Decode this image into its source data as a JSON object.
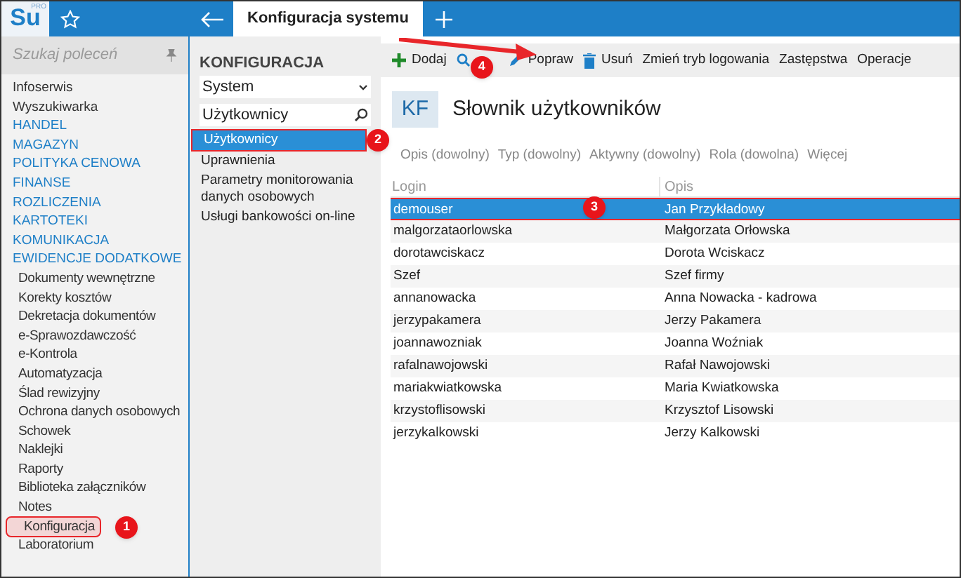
{
  "app": {
    "logo": "Su",
    "logo_badge": "PRO"
  },
  "tabs": [
    {
      "label": "Konfiguracja systemu",
      "selected": true
    }
  ],
  "sidebar": {
    "search": {
      "placeholder": "Szukaj poleceń"
    },
    "items": [
      {
        "label": "Infoserwis",
        "kind": "plain",
        "selected": false
      },
      {
        "label": "Wyszukiwarka",
        "kind": "plain",
        "selected": false
      },
      {
        "label": "HANDEL",
        "kind": "section",
        "selected": false
      },
      {
        "label": "MAGAZYN",
        "kind": "section",
        "selected": false
      },
      {
        "label": "POLITYKA CENOWA",
        "kind": "section",
        "selected": false
      },
      {
        "label": "FINANSE",
        "kind": "section",
        "selected": false
      },
      {
        "label": "ROZLICZENIA",
        "kind": "section",
        "selected": false
      },
      {
        "label": "KARTOTEKI",
        "kind": "section",
        "selected": false
      },
      {
        "label": "KOMUNIKACJA",
        "kind": "section",
        "selected": false
      },
      {
        "label": "EWIDENCJE DODATKOWE",
        "kind": "section",
        "selected": false,
        "children": [
          {
            "label": "Dokumenty wewnętrzne",
            "selected": false
          },
          {
            "label": "Korekty kosztów",
            "selected": false
          },
          {
            "label": "Dekretacja dokumentów",
            "selected": false
          },
          {
            "label": "e-Sprawozdawczość",
            "selected": false
          },
          {
            "label": "e-Kontrola",
            "selected": false
          },
          {
            "label": "Automatyzacja",
            "selected": false
          },
          {
            "label": "Ślad rewizyjny",
            "selected": false
          },
          {
            "label": "Ochrona danych osobowych",
            "selected": false
          },
          {
            "label": "Schowek",
            "selected": false
          },
          {
            "label": "Naklejki",
            "selected": false
          },
          {
            "label": "Raporty",
            "selected": false
          },
          {
            "label": "Biblioteka załączników",
            "selected": false
          },
          {
            "label": "Notes",
            "selected": false
          },
          {
            "label": "Konfiguracja",
            "selected": true,
            "badge": "1"
          },
          {
            "label": "Laboratorium",
            "selected": false
          }
        ]
      }
    ]
  },
  "config_panel": {
    "title": "KONFIGURACJA",
    "dropdown": "System",
    "search": {
      "value": "Użytkownicy"
    },
    "items": [
      {
        "label": "Użytkownicy",
        "selected": true,
        "badge": "2"
      },
      {
        "label": "Uprawnienia",
        "selected": false
      },
      {
        "label": "Parametry monitorowania danych osobowych",
        "selected": false
      },
      {
        "label": "Usługi bankowości on-line",
        "selected": false
      }
    ]
  },
  "toolbar": [
    {
      "label": "Dodaj",
      "kind": "add"
    },
    {
      "kind": "view",
      "badge": "4"
    },
    {
      "label": "Popraw",
      "kind": "edit"
    },
    {
      "label": "Usuń",
      "kind": "delete"
    },
    {
      "label": "Zmień tryb logowania",
      "kind": "text"
    },
    {
      "label": "Zastępstwa",
      "kind": "text"
    },
    {
      "label": "Operacje",
      "kind": "text"
    }
  ],
  "page": {
    "initials": "KF",
    "title": "Słownik użytkowników"
  },
  "filters": [
    "Opis (dowolny)",
    "Typ (dowolny)",
    "Aktywny (dowolny)",
    "Rola (dowolna)",
    "Więcej"
  ],
  "table": {
    "columns": [
      "Login",
      "Opis"
    ],
    "rows": [
      {
        "login": "demouser",
        "opis": "Jan Przykładowy",
        "selected": true,
        "badge": "3"
      },
      {
        "login": "malgorzataorlowska",
        "opis": "Małgorzata Orłowska",
        "selected": false
      },
      {
        "login": "dorotawciskacz",
        "opis": "Dorota Wciskacz",
        "selected": false
      },
      {
        "login": "Szef",
        "opis": "Szef firmy",
        "selected": false
      },
      {
        "login": "annanowacka",
        "opis": "Anna Nowacka - kadrowa",
        "selected": false
      },
      {
        "login": "jerzypakamera",
        "opis": "Jerzy Pakamera",
        "selected": false
      },
      {
        "login": "joannawozniak",
        "opis": "Joanna Woźniak",
        "selected": false
      },
      {
        "login": "rafalnawojowski",
        "opis": "Rafał Nawojowski",
        "selected": false
      },
      {
        "login": "mariakwiatkowska",
        "opis": "Maria Kwiatkowska",
        "selected": false
      },
      {
        "login": "krzystoflisowski",
        "opis": "Krzysztof Lisowski",
        "selected": false
      },
      {
        "login": "jerzykalkowski",
        "opis": "Jerzy Kalkowski",
        "selected": false
      }
    ]
  }
}
